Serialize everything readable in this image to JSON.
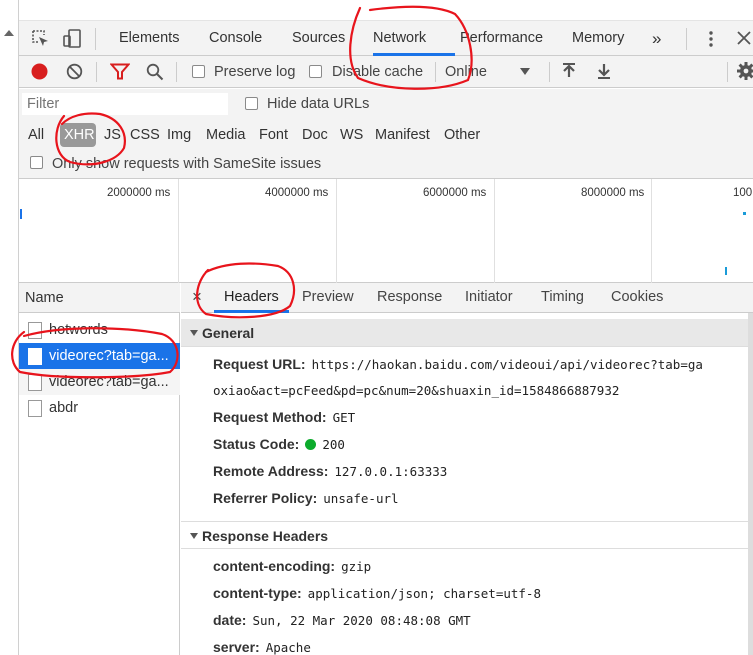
{
  "devtools": {
    "tabs": [
      "Elements",
      "Console",
      "Sources",
      "Network",
      "Performance",
      "Memory"
    ],
    "more_tabs_icon": "chevron-double-right-icon",
    "active_tab": "Network"
  },
  "toolbar": {
    "preserve_log": "Preserve log",
    "disable_cache": "Disable cache",
    "throttle": "Online"
  },
  "filter": {
    "placeholder": "Filter",
    "hide_data_urls": "Hide data URLs",
    "types": [
      "All",
      "XHR",
      "JS",
      "CSS",
      "Img",
      "Media",
      "Font",
      "Doc",
      "WS",
      "Manifest",
      "Other"
    ],
    "active_type": "XHR",
    "samesite_label": "Only show requests with SameSite issues"
  },
  "overview": {
    "ticks": [
      "2000000 ms",
      "4000000 ms",
      "6000000 ms",
      "8000000 ms",
      "100"
    ]
  },
  "requests": {
    "column_header": "Name",
    "items": [
      {
        "name": "hotwords",
        "selected": false
      },
      {
        "name": "videorec?tab=ga...",
        "selected": true
      },
      {
        "name": "videorec?tab=ga...",
        "selected": false
      },
      {
        "name": "abdr",
        "selected": false
      }
    ]
  },
  "detail": {
    "close_label": "×",
    "tabs": [
      "Headers",
      "Preview",
      "Response",
      "Initiator",
      "Timing",
      "Cookies"
    ],
    "active_tab": "Headers",
    "general": {
      "title": "General",
      "request_url_key": "Request URL:",
      "request_url_line1": "https://haokan.baidu.com/videoui/api/videorec?tab=ga",
      "request_url_line2": "oxiao&act=pcFeed&pd=pc&num=20&shuaxin_id=1584866887932",
      "method_key": "Request Method:",
      "method": "GET",
      "status_key": "Status Code:",
      "status": "200",
      "remote_key": "Remote Address:",
      "remote": "127.0.0.1:63333",
      "referrer_key": "Referrer Policy:",
      "referrer": "unsafe-url"
    },
    "response_headers": {
      "title": "Response Headers",
      "items": [
        {
          "key": "content-encoding:",
          "value": "gzip"
        },
        {
          "key": "content-type:",
          "value": "application/json; charset=utf-8"
        },
        {
          "key": "date:",
          "value": "Sun, 22 Mar 2020 08:48:08 GMT"
        },
        {
          "key": "server:",
          "value": "Apache"
        }
      ]
    }
  },
  "colors": {
    "accent": "#1a73e8",
    "annotation": "#e8141c",
    "status_ok": "#0cab2c"
  }
}
